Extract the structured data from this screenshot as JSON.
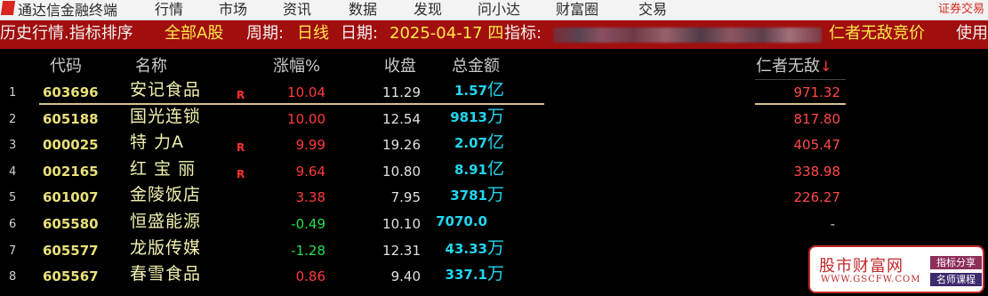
{
  "menubar": {
    "app_title": "通达信金融终端",
    "items": [
      "行情",
      "市场",
      "资讯",
      "数据",
      "发现",
      "问小达",
      "财富圈",
      "交易"
    ],
    "broker_link": "证券交易"
  },
  "titlebar": {
    "section": "历史行情.指标排序",
    "board": "全部A股",
    "period_label": "周期:",
    "period_value": "日线",
    "date_label": "日期:",
    "date_value": "2025-04-17 四",
    "indicator_label": "指标:",
    "indicator_suffix": "仁者无敌竞价",
    "trailing": "使用"
  },
  "table": {
    "headers": {
      "code": "代码",
      "name": "名称",
      "change": "涨幅%",
      "close": "收盘",
      "amount": "总金额",
      "indicator": "仁者无敌",
      "sort_arrow": "↓"
    },
    "rows": [
      {
        "idx": "1",
        "code": "603696",
        "name": "安记食品",
        "flag": "R",
        "change": "10.04",
        "dir": "up",
        "close": "11.29",
        "amount": "1.57",
        "unit": "亿",
        "rzwd": "971.32"
      },
      {
        "idx": "2",
        "code": "605188",
        "name": "国光连锁",
        "flag": "",
        "change": "10.00",
        "dir": "up",
        "close": "12.54",
        "amount": "9813",
        "unit": "万",
        "rzwd": "817.80"
      },
      {
        "idx": "3",
        "code": "000025",
        "name": "特 力A",
        "flag": "R",
        "change": "9.99",
        "dir": "up",
        "close": "19.26",
        "amount": "2.07",
        "unit": "亿",
        "rzwd": "405.47"
      },
      {
        "idx": "4",
        "code": "002165",
        "name": "红 宝 丽",
        "flag": "R",
        "change": "9.64",
        "dir": "up",
        "close": "10.80",
        "amount": "8.91",
        "unit": "亿",
        "rzwd": "338.98"
      },
      {
        "idx": "5",
        "code": "601007",
        "name": "金陵饭店",
        "flag": "",
        "change": "3.38",
        "dir": "up",
        "close": "7.95",
        "amount": "3781",
        "unit": "万",
        "rzwd": "226.27"
      },
      {
        "idx": "6",
        "code": "605580",
        "name": "恒盛能源",
        "flag": "",
        "change": "-0.49",
        "dir": "down",
        "close": "10.10",
        "amount": "7070.0",
        "unit": "",
        "rzwd": "-"
      },
      {
        "idx": "7",
        "code": "605577",
        "name": "龙版传媒",
        "flag": "",
        "change": "-1.28",
        "dir": "down",
        "close": "12.31",
        "amount": "43.33",
        "unit": "万",
        "rzwd": ""
      },
      {
        "idx": "8",
        "code": "605567",
        "name": "春雪食品",
        "flag": "",
        "change": "0.86",
        "dir": "up",
        "close": "9.40",
        "amount": "337.1",
        "unit": "万",
        "rzwd": ""
      }
    ]
  },
  "watermark": {
    "title": "股市财富网",
    "url": "WWW.GSCFW.COM",
    "tag1": "指标分享",
    "tag2": "名师课程"
  }
}
